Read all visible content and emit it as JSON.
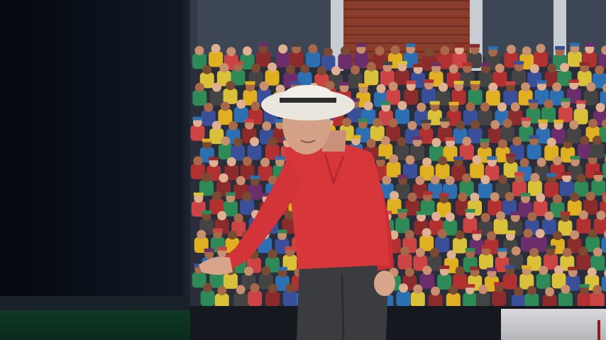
{
  "scene": {
    "type": "cricket-broadcast-view",
    "subject": "umpire",
    "colors": {
      "umpire_shirt": "#d7363b",
      "umpire_trousers": "#3a3c40",
      "umpire_hat": "#e9e6de",
      "sightscreen": "#0c131d",
      "ground": "#0f3826"
    }
  }
}
